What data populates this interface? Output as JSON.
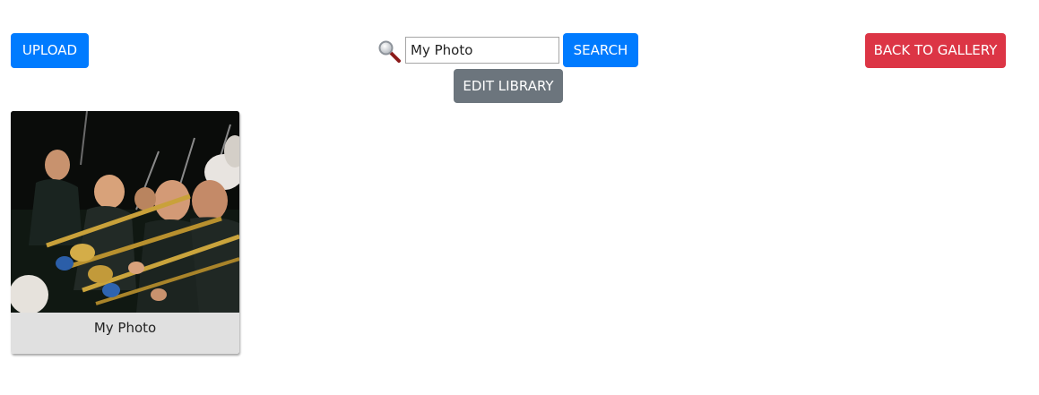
{
  "toolbar": {
    "upload_label": "UPLOAD",
    "search_label": "SEARCH",
    "back_label": "BACK TO GALLERY",
    "edit_library_label": "EDIT LIBRARY"
  },
  "search": {
    "value": "My Photo",
    "icon": "magnifier-icon"
  },
  "photos": [
    {
      "caption": "My Photo"
    }
  ],
  "colors": {
    "primary": "#007bff",
    "danger": "#dc3545",
    "secondary": "#6c757d",
    "caption_bg": "#e0e0e0"
  }
}
